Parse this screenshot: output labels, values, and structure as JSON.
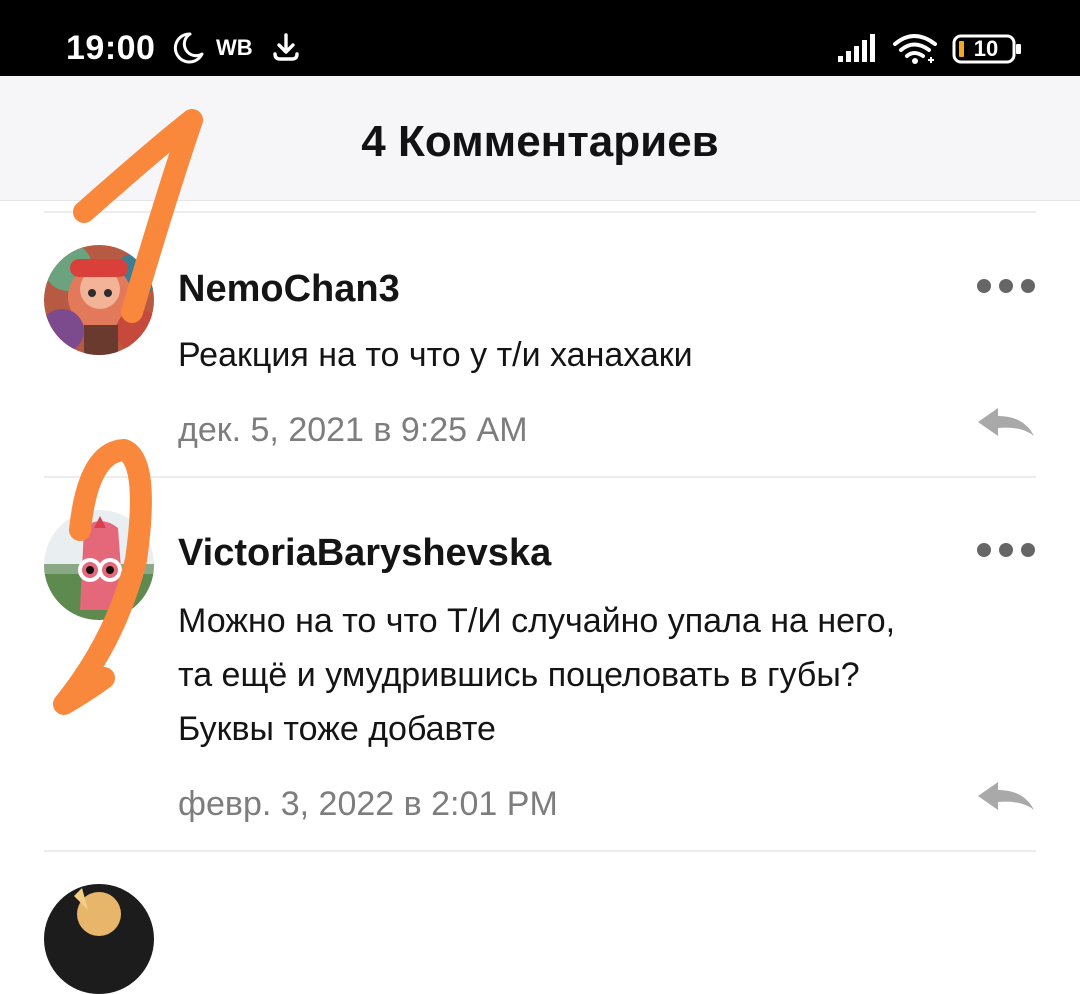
{
  "status_bar": {
    "time": "19:00",
    "carrier_badge": "WB",
    "battery_level": "10",
    "icons": [
      "moon-icon",
      "download-icon",
      "signal-icon",
      "wifi-icon",
      "battery-icon"
    ]
  },
  "header": {
    "title": "4 Комментариев"
  },
  "comments": [
    {
      "username": "NemoChan3",
      "text_lines": [
        "Реакция на то что у т/и ханахаки"
      ],
      "date": "дек. 5, 2021 в 9:25 AM",
      "icons": [
        "avatar",
        "more-icon",
        "reply-icon"
      ]
    },
    {
      "username": "VictoriaBaryshevska",
      "text_lines": [
        "Можно на то что Т/И случайно упала на него,",
        "та ещё и умудрившись поцеловать в губы?",
        "Буквы тоже добавте"
      ],
      "date": "февр. 3, 2022 в 2:01 PM",
      "icons": [
        "avatar",
        "more-icon",
        "reply-icon"
      ]
    }
  ],
  "annotations": {
    "color": "#f9873c",
    "digits": [
      "1",
      "2"
    ]
  },
  "colors": {
    "status_bar_bg": "#000000",
    "header_bg": "#f6f5f8",
    "text": "#141414",
    "meta_text": "#7d7d7d",
    "icon_gray": "#666666",
    "annotation": "#f9873c"
  }
}
